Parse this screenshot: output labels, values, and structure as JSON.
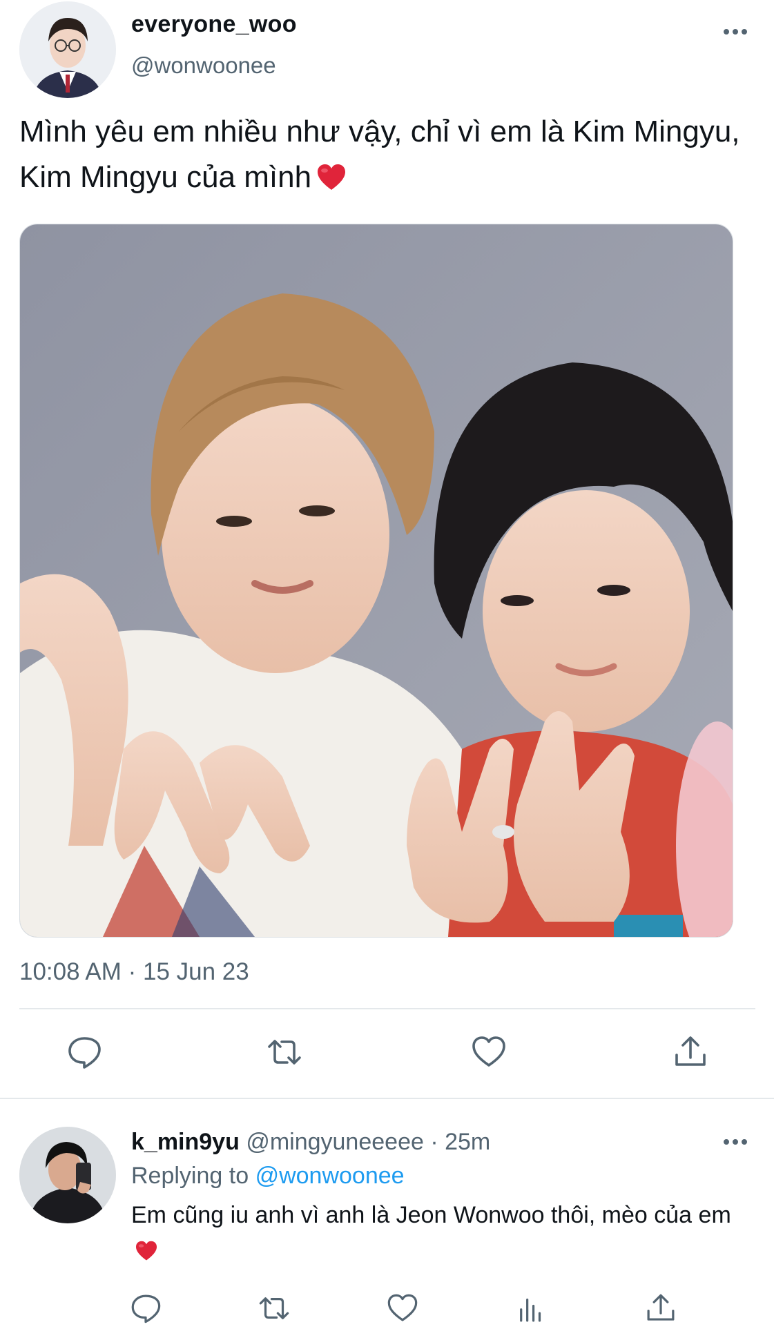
{
  "main_tweet": {
    "display_name": "everyone_woo",
    "handle": "@wonwoonee",
    "text": "Mình yêu em nhiều như vậy, chỉ vì em là Kim Mingyu, Kim Mingyu của mình",
    "emoji": "red-heart",
    "timestamp": "10:08 AM · 15 Jun 23",
    "actions": [
      "reply-icon",
      "retweet-icon",
      "like-icon",
      "share-icon"
    ]
  },
  "reply_tweet": {
    "display_name": "k_min9yu",
    "meta": "@mingyuneeeee · 25m",
    "replying_prefix": "Replying to",
    "replying_handle": "@wonwoonee",
    "text": "Em cũng iu anh vì anh là Jeon Wonwoo thôi, mèo của em",
    "emoji": "red-heart",
    "actions": [
      "reply-icon",
      "retweet-icon",
      "like-icon",
      "stats-icon",
      "share-icon"
    ]
  },
  "colors": {
    "primary_text": "#0f1419",
    "secondary_text": "#536471",
    "link": "#1d9bf0",
    "divider": "#e4e8eb",
    "heart_emoji": "#e0243a"
  }
}
